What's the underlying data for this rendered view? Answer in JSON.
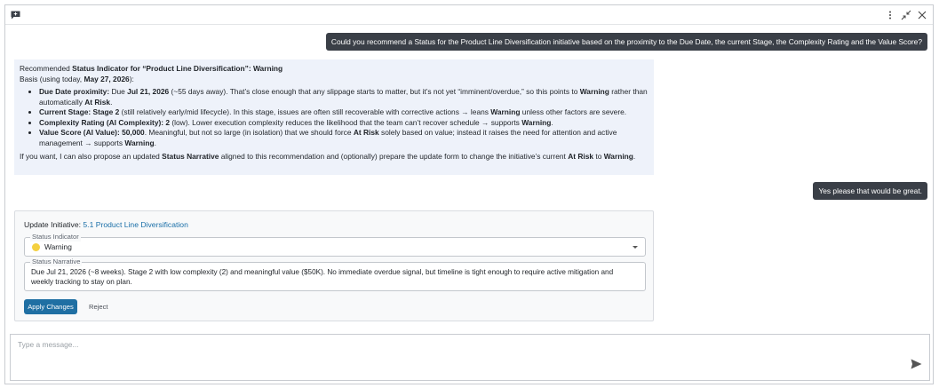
{
  "composer": {
    "placeholder": "Type a message..."
  },
  "messages": {
    "user_1": "Could you recommend a Status for the Product Line Diversification initiative based on the proximity to the Due Date, the current Stage, the Complexity Rating and the Value Score?",
    "user_2": "Yes please that would be great."
  },
  "assistant": {
    "rec_prefix": "Recommended ",
    "rec_bold": "Status Indicator for “Product Line Diversification”: Warning",
    "basis_prefix": "Basis (using today, ",
    "basis_date": "May 27, 2026",
    "basis_suffix": "):",
    "bullets": [
      {
        "parts": [
          [
            "b",
            "Due Date proximity: "
          ],
          [
            "t",
            "Due "
          ],
          [
            "b",
            "Jul 21, 2026"
          ],
          [
            "t",
            " (~55 days away). That’s close enough that any slippage starts to matter, but it’s not yet “imminent/overdue,” so this points to "
          ],
          [
            "b",
            "Warning"
          ],
          [
            "t",
            " rather than automatically "
          ],
          [
            "b",
            "At Risk"
          ],
          [
            "t",
            "."
          ]
        ]
      },
      {
        "parts": [
          [
            "b",
            "Current Stage: Stage 2"
          ],
          [
            "t",
            " (still relatively early/mid lifecycle). In this stage, issues are often still recoverable with corrective actions → leans "
          ],
          [
            "b",
            "Warning"
          ],
          [
            "t",
            " unless other factors are severe."
          ]
        ]
      },
      {
        "parts": [
          [
            "b",
            "Complexity Rating (AI Complexity): 2"
          ],
          [
            "t",
            " (low). Lower execution complexity reduces the likelihood that the team can’t recover schedule → supports "
          ],
          [
            "b",
            "Warning"
          ],
          [
            "t",
            "."
          ]
        ]
      },
      {
        "parts": [
          [
            "b",
            "Value Score (AI Value): 50,000"
          ],
          [
            "t",
            ". Meaningful, but not so large (in isolation) that we should force "
          ],
          [
            "b",
            "At Risk"
          ],
          [
            "t",
            " solely based on value; instead it raises the need for attention and active management → supports "
          ],
          [
            "b",
            "Warning"
          ],
          [
            "t",
            "."
          ]
        ]
      }
    ],
    "closing": [
      [
        "t",
        "If you want, I can also propose an updated "
      ],
      [
        "b",
        "Status Narrative"
      ],
      [
        "t",
        " aligned to this recommendation and (optionally) prepare the update form to change the initiative’s current "
      ],
      [
        "b",
        "At Risk"
      ],
      [
        "t",
        " to "
      ],
      [
        "b",
        "Warning"
      ],
      [
        "t",
        "."
      ]
    ]
  },
  "update_card": {
    "title_prefix": "Update Initiative: ",
    "initiative_link": "5.1 Product Line Diversification",
    "status_label": "Status Indicator",
    "status_value": "Warning",
    "status_color": "#f4d03f",
    "narrative_label": "Status Narrative",
    "narrative_value": "Due Jul 21, 2026 (~8 weeks). Stage 2 with low complexity (2) and meaningful value ($50K). No immediate overdue signal, but timeline is tight enough to require active mitigation and weekly tracking to stay on plan.",
    "apply_label": "Apply Changes",
    "reject_label": "Reject"
  },
  "colors": {
    "user_bubble": "#3a3f47",
    "assistant_bg": "#eef2fa",
    "primary_button": "#1f6fa3",
    "link": "#1a6fa8"
  },
  "icons": {
    "topbar_left": "feedback-icon",
    "window_controls": [
      "more-vertical-icon",
      "collapse-icon",
      "close-icon"
    ],
    "send": "send-icon"
  }
}
